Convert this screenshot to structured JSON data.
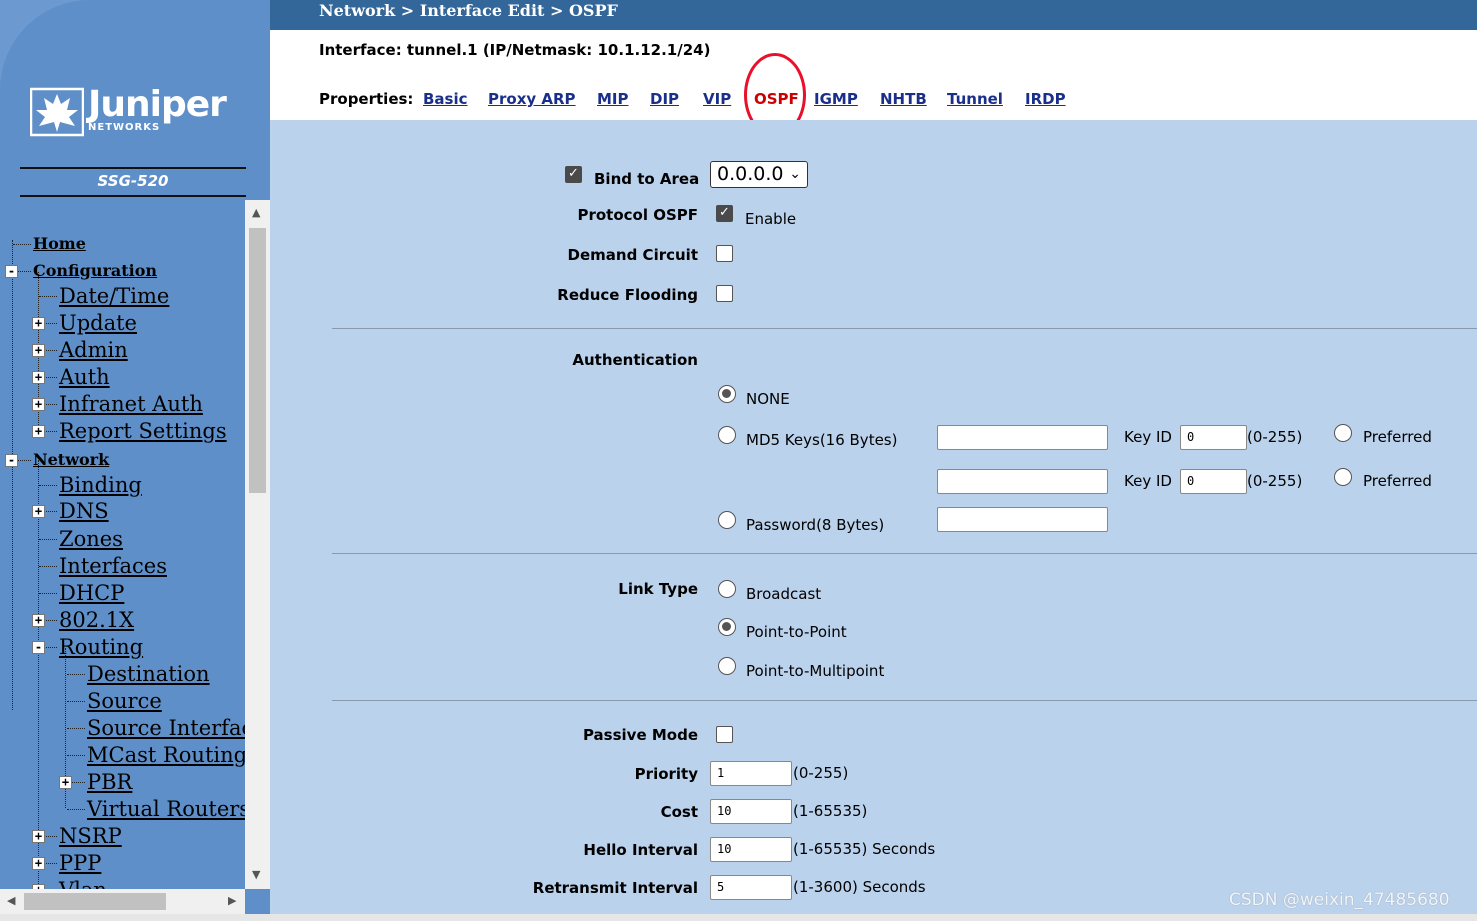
{
  "breadcrumb": "Network > Interface Edit > OSPF",
  "brand": {
    "name": "Juniper",
    "sub": "NETWORKS",
    "model": "SSG-520"
  },
  "nav": [
    {
      "label": "Home",
      "toggle": ""
    },
    {
      "label": "Configuration",
      "toggle": "-"
    },
    {
      "label": "Date/Time",
      "toggle": ""
    },
    {
      "label": "Update",
      "toggle": "+"
    },
    {
      "label": "Admin",
      "toggle": "+"
    },
    {
      "label": "Auth",
      "toggle": "+"
    },
    {
      "label": "Infranet Auth",
      "toggle": "+"
    },
    {
      "label": "Report Settings",
      "toggle": "+"
    },
    {
      "label": "Network",
      "toggle": "-"
    },
    {
      "label": "Binding",
      "toggle": ""
    },
    {
      "label": "DNS",
      "toggle": "+"
    },
    {
      "label": "Zones",
      "toggle": ""
    },
    {
      "label": "Interfaces",
      "toggle": ""
    },
    {
      "label": "DHCP",
      "toggle": ""
    },
    {
      "label": "802.1X",
      "toggle": "+"
    },
    {
      "label": "Routing",
      "toggle": "-"
    },
    {
      "label": "Destination",
      "toggle": ""
    },
    {
      "label": "Source",
      "toggle": ""
    },
    {
      "label": "Source Interface",
      "toggle": ""
    },
    {
      "label": "MCast Routing",
      "toggle": ""
    },
    {
      "label": "PBR",
      "toggle": "+"
    },
    {
      "label": "Virtual Routers",
      "toggle": ""
    },
    {
      "label": "NSRP",
      "toggle": "+"
    },
    {
      "label": "PPP",
      "toggle": "+"
    },
    {
      "label": "Vlan",
      "toggle": "+"
    }
  ],
  "interface_line": "Interface: tunnel.1 (IP/Netmask: 10.1.12.1/24)",
  "properties_label": "Properties:",
  "tabs": [
    "Basic",
    "Proxy ARP",
    "MIP",
    "DIP",
    "VIP",
    "OSPF",
    "IGMP",
    "NHTB",
    "Tunnel",
    "IRDP"
  ],
  "active_tab": "OSPF",
  "form": {
    "bind_to_area": {
      "label": "Bind to Area",
      "checked": true,
      "value": "0.0.0.0"
    },
    "protocol_ospf": {
      "label": "Protocol OSPF",
      "checked": true,
      "text": "Enable"
    },
    "demand_circuit": {
      "label": "Demand Circuit",
      "checked": false
    },
    "reduce_flooding": {
      "label": "Reduce Flooding",
      "checked": false
    },
    "authentication": {
      "label": "Authentication",
      "none_label": "NONE",
      "md5_label": "MD5 Keys(16 Bytes)",
      "password_label": "Password(8 Bytes)",
      "selected": "NONE",
      "key_id_label": "Key ID",
      "key_id_1": "0",
      "key_id_2": "0",
      "range": "(0-255)",
      "preferred_label": "Preferred"
    },
    "link_type": {
      "label": "Link Type",
      "options": [
        "Broadcast",
        "Point-to-Point",
        "Point-to-Multipoint"
      ],
      "selected": "Point-to-Point"
    },
    "passive_mode": {
      "label": "Passive Mode",
      "checked": false
    },
    "priority": {
      "label": "Priority",
      "value": "1",
      "hint": "(0-255)"
    },
    "cost": {
      "label": "Cost",
      "value": "10",
      "hint": "(1-65535)"
    },
    "hello_interval": {
      "label": "Hello Interval",
      "value": "10",
      "hint": "(1-65535) Seconds"
    },
    "retransmit_interval": {
      "label": "Retransmit Interval",
      "value": "5",
      "hint": "(1-3600) Seconds"
    }
  },
  "watermark": "CSDN @weixin_47485680",
  "colors": {
    "header": "#336699",
    "sidebar": "#5f8fc8",
    "form_bg": "#bbd2ec",
    "tab_link": "#1a2f8a",
    "annotation": "#e8102a"
  }
}
